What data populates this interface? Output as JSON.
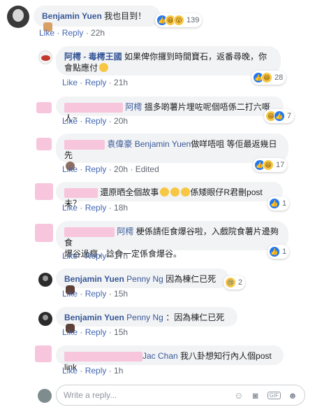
{
  "labels": {
    "like": "Like",
    "reply": "Reply",
    "sep": " · "
  },
  "comments": [
    {
      "author": "Benjamin Yuen",
      "text": "我也目到！",
      "time": "22h",
      "reaction_count": "139"
    },
    {
      "author": "阿樗 - 毒樗王國",
      "text": "如果俾你攞到時間寶石，返番尋晚，你會點應付",
      "time": "21h",
      "reaction_count": "28"
    },
    {
      "mention": "阿樗",
      "text": "搵多啲薯片埋咗呢個唔係二打六嘅人~",
      "time": "20h",
      "reaction_count": "7"
    },
    {
      "author": "袁偉豪",
      "mention": "Benjamin Yuen",
      "text": "做咩唔咀 等佢最返幾日先",
      "time": "20h",
      "edited": "Edited",
      "reaction_count": "17"
    },
    {
      "text": "還原晒全個故事",
      "text2": "係矮眼仔R君刪post未？",
      "time": "18h",
      "reaction_count": "1"
    },
    {
      "mention": "阿樗",
      "text": "梗係請佢食爆谷啦，入戲院食薯片邊夠食",
      "text_line2": "爆谷過癮，諗食一定係食爆谷。",
      "time": "17h",
      "reaction_count": "1"
    },
    {
      "author": "Benjamin Yuen",
      "mention": "Penny Ng",
      "text": "因為棟仁已死",
      "time": "15h",
      "reaction_count": "2"
    },
    {
      "author": "Benjamin Yuen",
      "mention": "Penny Ng",
      "text": "：因為棟仁已死",
      "time": "15h"
    },
    {
      "mention": "Jac Chan",
      "text": "我八卦想知行內人個post link",
      "time": "1h"
    }
  ],
  "reply_box": {
    "placeholder": "Write a reply..."
  },
  "icons": [
    "emoji-icon",
    "camera-icon",
    "gif-icon",
    "sticker-icon"
  ]
}
